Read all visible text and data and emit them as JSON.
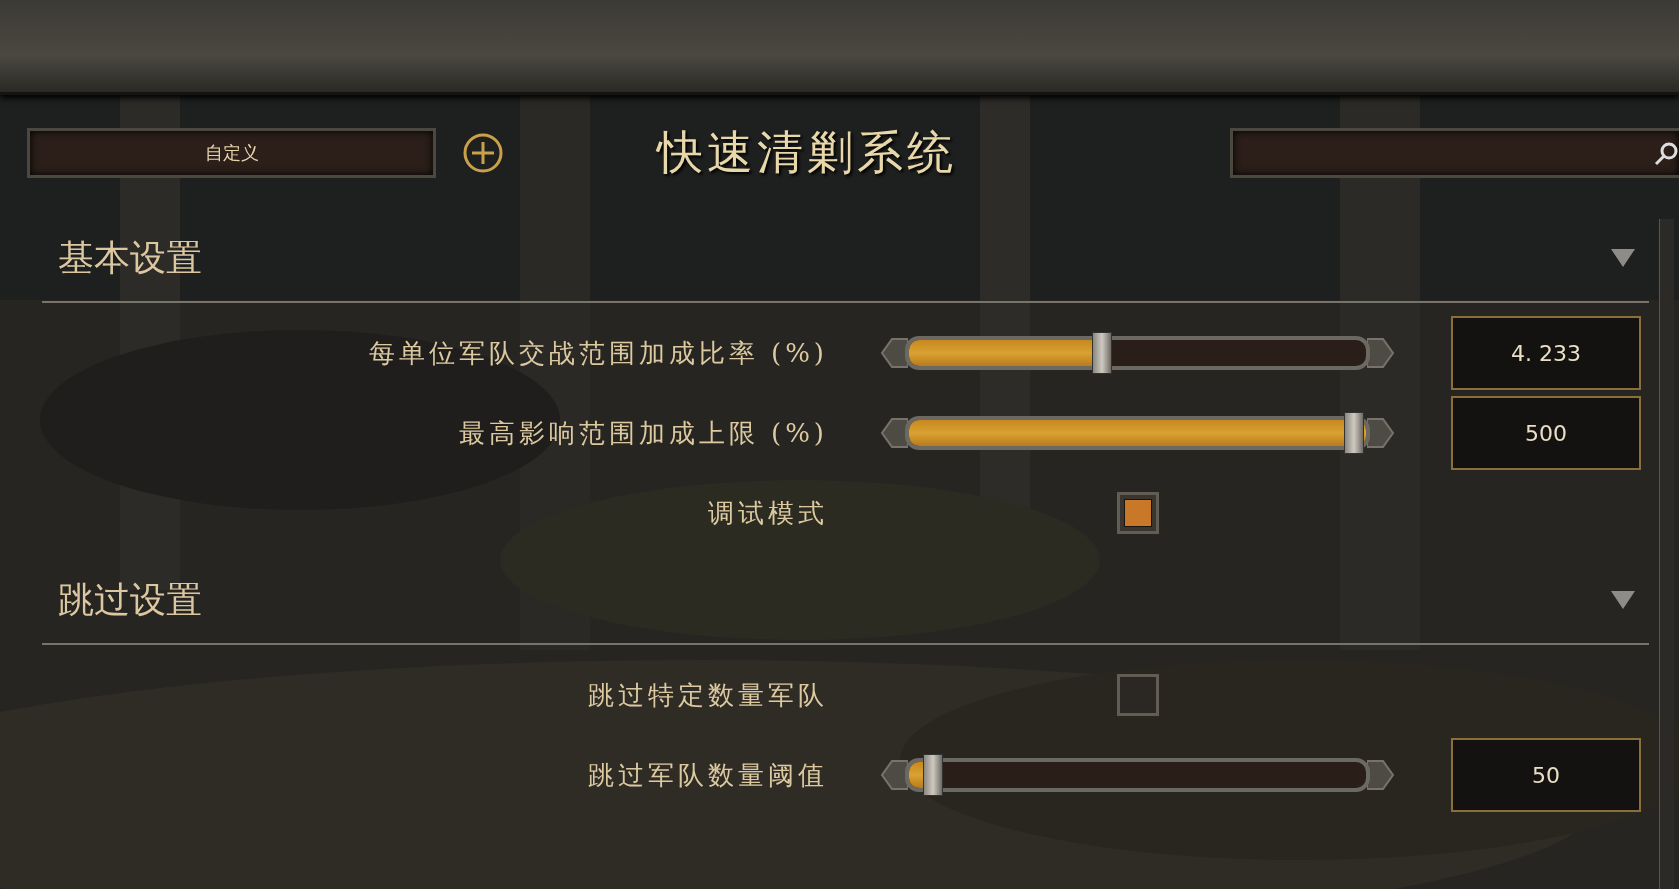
{
  "preset": {
    "value": "自定义"
  },
  "title": "快速清剿系统",
  "sections": [
    {
      "title": "基本设置",
      "expanded": true,
      "rows": [
        {
          "kind": "slider",
          "label": "每单位军队交战范围加成比率 (%)",
          "level": 0.42,
          "value": "4. 233"
        },
        {
          "kind": "slider",
          "label": "最高影响范围加成上限 (%)",
          "level": 1,
          "value": "500"
        },
        {
          "kind": "checkbox",
          "label": "调试模式",
          "checked": true
        }
      ]
    },
    {
      "title": "跳过设置",
      "expanded": true,
      "rows": [
        {
          "kind": "checkbox",
          "label": "跳过特定数量军队",
          "checked": false
        },
        {
          "kind": "slider",
          "label": "跳过军队数量阈值",
          "level": 0.03,
          "value": "50"
        }
      ]
    }
  ]
}
